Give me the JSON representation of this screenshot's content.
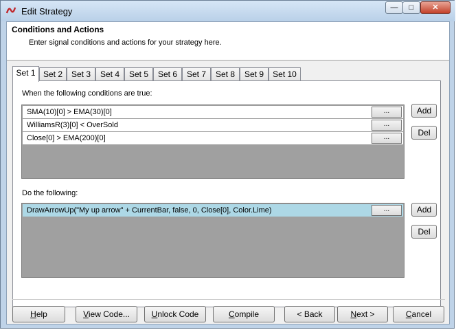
{
  "window": {
    "title": "Edit Strategy",
    "app_icon": "ninjatrader-logo-icon",
    "caption_buttons": {
      "minimize": "—",
      "maximize": "□",
      "close": "✕"
    }
  },
  "header": {
    "title": "Conditions and Actions",
    "subtitle": "Enter signal conditions and actions for your strategy here."
  },
  "tabs": [
    "Set 1",
    "Set 2",
    "Set 3",
    "Set 4",
    "Set 5",
    "Set 6",
    "Set 7",
    "Set 8",
    "Set 9",
    "Set 10"
  ],
  "active_tab": "Set 1",
  "conditions": {
    "label": "When the following conditions are true:",
    "rows": [
      "SMA(10)[0] > EMA(30)[0]",
      "WilliamsR(3)[0] < OverSold",
      "Close[0] > EMA(200)[0]"
    ],
    "add_label": "Add",
    "del_label": "Del"
  },
  "actions": {
    "label": "Do the following:",
    "rows": [
      "DrawArrowUp(\"My up arrow\" + CurrentBar, false, 0, Close[0], Color.Lime)"
    ],
    "add_label": "Add",
    "del_label": "Del"
  },
  "row_button_label": "...",
  "footer": {
    "help": "Help",
    "view_code": "View Code...",
    "unlock_code": "Unlock Code",
    "compile": "Compile",
    "back": "< Back",
    "next": "Next >",
    "cancel": "Cancel"
  },
  "colors": {
    "selected_row": "#add8e6",
    "list_background": "#a0a0a0",
    "close_button": "#c4422b"
  }
}
